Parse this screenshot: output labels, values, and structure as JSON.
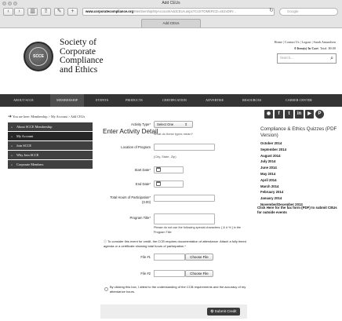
{
  "window": {
    "title": "Add CEUs",
    "tab_label": "Add CEUs",
    "url_host": "www.corporatecompliance.org",
    "url_path": "/Membership/MyAccount/AddCEUs.aspx?CUSTOMERCD=xE2xD9Y...",
    "search_placeholder": "Google"
  },
  "site": {
    "logo_abbrev": "SCCE",
    "logo_lines": [
      "Society of",
      "Corporate",
      "Compliance",
      "and Ethics"
    ],
    "util_links": "Home | Contact Us | Logout | Sarah Amundsen",
    "cart_count_text": "0 Item(s) In Cart",
    "cart_total_text": "Total: $0.00",
    "search_placeholder": "Search..."
  },
  "nav": {
    "items": [
      {
        "label": "ABOUT SCCE"
      },
      {
        "label": "MEMBERSHIP"
      },
      {
        "label": "EVENTS"
      },
      {
        "label": "PRODUCTS"
      },
      {
        "label": "CERTIFICATION"
      },
      {
        "label": "ADVERTISE"
      },
      {
        "label": "RESOURCES"
      },
      {
        "label": "CAREER CENTER"
      }
    ]
  },
  "breadcrumb": "You are here: Membership > My Account > Add CEUs",
  "left_nav": {
    "items": [
      {
        "label": "About SCCE Membership"
      },
      {
        "label": "My Account"
      },
      {
        "label": "Join SCCE"
      },
      {
        "label": "Why Join SCCE"
      },
      {
        "label": "Corporate Members"
      }
    ]
  },
  "form": {
    "title": "Enter Activity Detail",
    "activity_type_label": "Activity Type*",
    "activity_type_value": "Select One",
    "activity_type_hint": "What do these types mean?",
    "location_label": "Location of Program",
    "location_hint": "(City, State, Zip)",
    "start_date_label": "Start Date*",
    "end_date_label": "End Date*",
    "total_hours_label": "Total Hours of Participation*",
    "total_hours_sub": "(0.00)",
    "program_title_label": "Program Title*",
    "program_title_hint": "Please do not use the following special characters: [ & # % ] in the Program Title",
    "ccb_note": "To consider this event for credit, the CCB requires documentation of attendance. Attach a fully timed agenda or a certificate showing total hours of participation.*",
    "file1_label": "File #1",
    "file2_label": "File #2",
    "choose_file_label": "Choose File",
    "attest_text": "By clicking this box, I attest to the understanding of the CCB requirements and the accuracy of my attendance hours.",
    "submit_label": "Submit Credit"
  },
  "right_sidebar": {
    "social_icons": [
      "rss-icon",
      "facebook-icon",
      "twitter-icon",
      "linkedin-icon",
      "youtube-icon",
      "pinterest-icon"
    ],
    "quiz_title": "Compliance & Ethics Quizzes (PDF Version)",
    "quiz_links": [
      "October 2014",
      "September 2014",
      "August 2014",
      "July 2014",
      "June 2014",
      "May 2014",
      "April 2014",
      "March 2014",
      "February 2014",
      "January 2014",
      "November/December 2013"
    ],
    "fax_note": "Click Here for the fax form (PDF) to submit CEUs for outside events"
  },
  "colors": {
    "nav_bg": "#343434",
    "sidebar_bg": "#404040",
    "submit_bg": "#3a3a3a"
  }
}
